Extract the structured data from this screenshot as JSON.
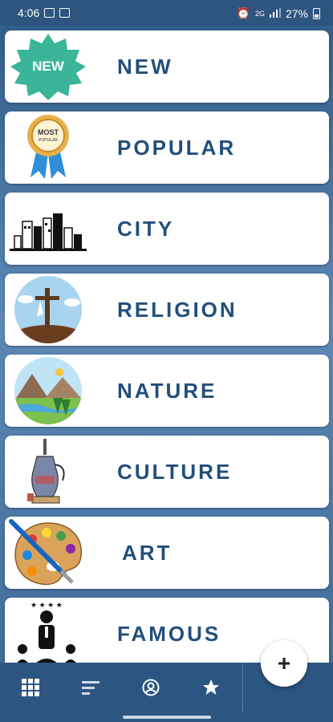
{
  "status_bar": {
    "time": "4:06",
    "battery": "27%",
    "network": "2G"
  },
  "categories": [
    {
      "label": "NEW",
      "icon": "new-badge-icon"
    },
    {
      "label": "POPULAR",
      "icon": "most-popular-ribbon-icon"
    },
    {
      "label": "CITY",
      "icon": "city-skyline-icon"
    },
    {
      "label": "RELIGION",
      "icon": "cross-hill-icon"
    },
    {
      "label": "NATURE",
      "icon": "mountain-landscape-icon"
    },
    {
      "label": "CULTURE",
      "icon": "ornate-jug-icon"
    },
    {
      "label": "ART",
      "icon": "paint-palette-icon"
    },
    {
      "label": "FAMOUS",
      "icon": "famous-person-icon"
    }
  ],
  "badges": {
    "new_text": "NEW",
    "popular_text_1": "MOST",
    "popular_text_2": "POPULAR"
  },
  "bottom_nav": {
    "items": [
      "grid-icon",
      "sort-icon",
      "account-icon",
      "star-icon"
    ],
    "fab_label": "+"
  },
  "colors": {
    "accent": "#214f7c",
    "nav_background": "#2c5681"
  }
}
